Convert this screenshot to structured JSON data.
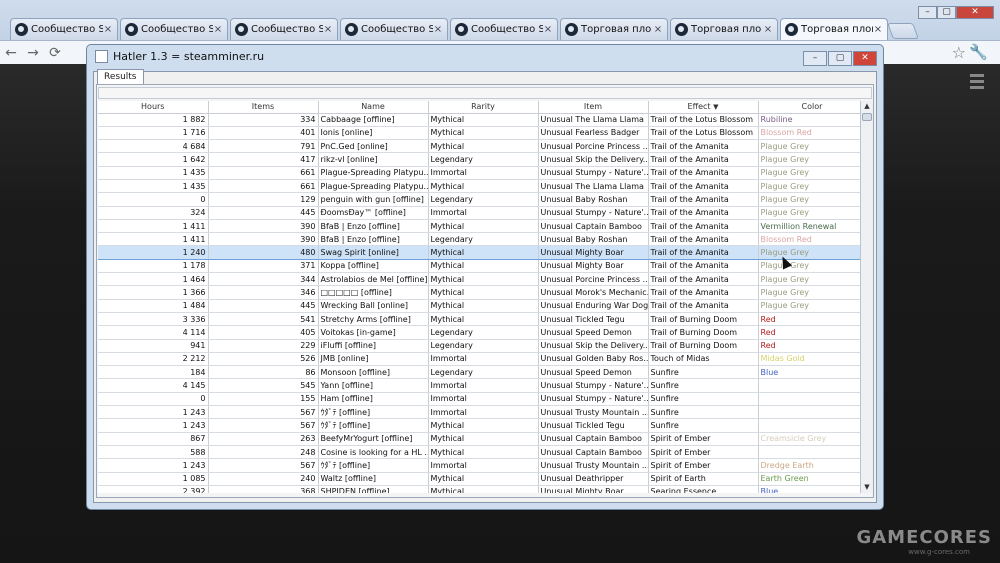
{
  "browser": {
    "tabs": [
      {
        "label": "Сообщество St"
      },
      {
        "label": "Сообщество St"
      },
      {
        "label": "Сообщество St"
      },
      {
        "label": "Сообщество St"
      },
      {
        "label": "Сообщество St"
      },
      {
        "label": "Торговая пло"
      },
      {
        "label": "Торговая пло"
      },
      {
        "label": "Торговая плош"
      }
    ],
    "close_glyph": "×",
    "back_glyph": "←",
    "forward_glyph": "→",
    "reload_glyph": "⟳",
    "star_glyph": "☆",
    "wrench_glyph": "🔧"
  },
  "app": {
    "title": "Hatler 1.3 = steamminer.ru",
    "results_tab": "Results",
    "columns": [
      "Hours",
      "Items",
      "Name",
      "Rarity",
      "Item",
      "Effect",
      "Color"
    ],
    "sort_arrow": "▼",
    "rows": [
      {
        "hours": "1 882",
        "items": "334",
        "name": "Cabbaage [offline]",
        "rarity": "Mythical",
        "item": "Unusual The Llama Llama",
        "effect": "Trail of the Lotus Blossom",
        "color": "Rubiline"
      },
      {
        "hours": "1 716",
        "items": "401",
        "name": "Ionis [online]",
        "rarity": "Mythical",
        "item": "Unusual Fearless Badger",
        "effect": "Trail of the Lotus Blossom",
        "color": "Blossom Red"
      },
      {
        "hours": "4 684",
        "items": "791",
        "name": "PnC.Ged [online]",
        "rarity": "Mythical",
        "item": "Unusual Porcine Princess ...",
        "effect": "Trail of the Amanita",
        "color": "Plague Grey"
      },
      {
        "hours": "1 642",
        "items": "417",
        "name": "rikz-vl [online]",
        "rarity": "Legendary",
        "item": "Unusual Skip the Delivery...",
        "effect": "Trail of the Amanita",
        "color": "Plague Grey"
      },
      {
        "hours": "1 435",
        "items": "661",
        "name": "Plague-Spreading Platypu...",
        "rarity": "Immortal",
        "item": "Unusual Stumpy - Nature'...",
        "effect": "Trail of the Amanita",
        "color": "Plague Grey"
      },
      {
        "hours": "1 435",
        "items": "661",
        "name": "Plague-Spreading Platypu...",
        "rarity": "Mythical",
        "item": "Unusual The Llama Llama",
        "effect": "Trail of the Amanita",
        "color": "Plague Grey"
      },
      {
        "hours": "0",
        "items": "129",
        "name": "penguin with gun [offline]",
        "rarity": "Legendary",
        "item": "Unusual Baby Roshan",
        "effect": "Trail of the Amanita",
        "color": "Plague Grey"
      },
      {
        "hours": "324",
        "items": "445",
        "name": "ĐoomsĐay™ [offline]",
        "rarity": "Immortal",
        "item": "Unusual Stumpy - Nature'...",
        "effect": "Trail of the Amanita",
        "color": "Plague Grey"
      },
      {
        "hours": "1 411",
        "items": "390",
        "name": "BfaB | Enzo [offline]",
        "rarity": "Mythical",
        "item": "Unusual Captain Bamboo",
        "effect": "Trail of the Amanita",
        "color": "Vermillion Renewal"
      },
      {
        "hours": "1 411",
        "items": "390",
        "name": "BfaB | Enzo [offline]",
        "rarity": "Legendary",
        "item": "Unusual Baby Roshan",
        "effect": "Trail of the Amanita",
        "color": "Blossom Red"
      },
      {
        "hours": "1 240",
        "items": "480",
        "name": "Swag Spirit [online]",
        "rarity": "Mythical",
        "item": "Unusual Mighty Boar",
        "effect": "Trail of the Amanita",
        "color": "Plague Grey",
        "selected": true
      },
      {
        "hours": "1 178",
        "items": "371",
        "name": "Koppa [offline]",
        "rarity": "Mythical",
        "item": "Unusual Mighty Boar",
        "effect": "Trail of the Amanita",
        "color": "Plague Grey"
      },
      {
        "hours": "1 464",
        "items": "344",
        "name": "Astrolabios de Mel [offline]",
        "rarity": "Mythical",
        "item": "Unusual Porcine Princess ...",
        "effect": "Trail of the Amanita",
        "color": "Plague Grey"
      },
      {
        "hours": "1 366",
        "items": "346",
        "name": "□□□□□ [offline]",
        "rarity": "Mythical",
        "item": "Unusual Morok's Mechanic...",
        "effect": "Trail of the Amanita",
        "color": "Plague Grey"
      },
      {
        "hours": "1 484",
        "items": "445",
        "name": "Wrecking Ball [online]",
        "rarity": "Mythical",
        "item": "Unusual Enduring War Dog",
        "effect": "Trail of the Amanita",
        "color": "Plague Grey"
      },
      {
        "hours": "3 336",
        "items": "541",
        "name": "Stretchy Arms [offline]",
        "rarity": "Mythical",
        "item": "Unusual Tickled Tegu",
        "effect": "Trail of Burning Doom",
        "color": "Red"
      },
      {
        "hours": "4 114",
        "items": "405",
        "name": "Voitokas [in-game]",
        "rarity": "Legendary",
        "item": "Unusual Speed Demon",
        "effect": "Trail of Burning Doom",
        "color": "Red"
      },
      {
        "hours": "941",
        "items": "229",
        "name": "iFluffi [offline]",
        "rarity": "Legendary",
        "item": "Unusual Skip the Delivery...",
        "effect": "Trail of Burning Doom",
        "color": "Red"
      },
      {
        "hours": "2 212",
        "items": "526",
        "name": "JMB [online]",
        "rarity": "Immortal",
        "item": "Unusual Golden Baby Ros...",
        "effect": "Touch of Midas",
        "color": "Midas Gold"
      },
      {
        "hours": "184",
        "items": "86",
        "name": "Monsoon [offline]",
        "rarity": "Legendary",
        "item": "Unusual Speed Demon",
        "effect": "Sunfire",
        "color": "Blue"
      },
      {
        "hours": "4 145",
        "items": "545",
        "name": "Yann [offline]",
        "rarity": "Immortal",
        "item": "Unusual Stumpy - Nature'...",
        "effect": "Sunfire",
        "color": ""
      },
      {
        "hours": "0",
        "items": "155",
        "name": "Ham [offline]",
        "rarity": "Immortal",
        "item": "Unusual Stumpy - Nature'...",
        "effect": "Sunfire",
        "color": ""
      },
      {
        "hours": "1 243",
        "items": "567",
        "name": "ｳﾀﾞﾃ [offline]",
        "rarity": "Immortal",
        "item": "Unusual Trusty Mountain ...",
        "effect": "Sunfire",
        "color": ""
      },
      {
        "hours": "1 243",
        "items": "567",
        "name": "ｳﾀﾞﾃ [offline]",
        "rarity": "Mythical",
        "item": "Unusual Tickled Tegu",
        "effect": "Sunfire",
        "color": ""
      },
      {
        "hours": "867",
        "items": "263",
        "name": "BeefyMrYogurt [offline]",
        "rarity": "Mythical",
        "item": "Unusual Captain Bamboo",
        "effect": "Spirit of Ember",
        "color": "Creamsicle Grey"
      },
      {
        "hours": "588",
        "items": "248",
        "name": "Cosine is looking for a HL ...",
        "rarity": "Mythical",
        "item": "Unusual Captain Bamboo",
        "effect": "Spirit of Ember",
        "color": ""
      },
      {
        "hours": "1 243",
        "items": "567",
        "name": "ｳﾀﾞﾃ [offline]",
        "rarity": "Immortal",
        "item": "Unusual Trusty Mountain ...",
        "effect": "Spirit of Ember",
        "color": "Dredge Earth"
      },
      {
        "hours": "1 085",
        "items": "240",
        "name": "Waltz [offline]",
        "rarity": "Mythical",
        "item": "Unusual Deathripper",
        "effect": "Spirit of Earth",
        "color": "Earth Green"
      },
      {
        "hours": "2 392",
        "items": "368",
        "name": "SHPIDEN [offline]",
        "rarity": "Mythical",
        "item": "Unusual Mighty Boar",
        "effect": "Searing Essence",
        "color": "Blue"
      }
    ]
  },
  "watermark": {
    "brand": "GAMECORES",
    "url": "www.g-cores.com"
  },
  "colors": {
    "Rubiline": "#7a5c86",
    "Blossom Red": "#d9a4a4",
    "Plague Grey": "#9a9d82",
    "Vermillion Renewal": "#4b6a4b",
    "Red": "#b31b1b",
    "Midas Gold": "#d8d26a",
    "Blue": "#3f5fbf",
    "Creamsicle Grey": "#d8cdbb",
    "Dredge Earth": "#c9a784",
    "Earth Green": "#6c9a4c"
  }
}
